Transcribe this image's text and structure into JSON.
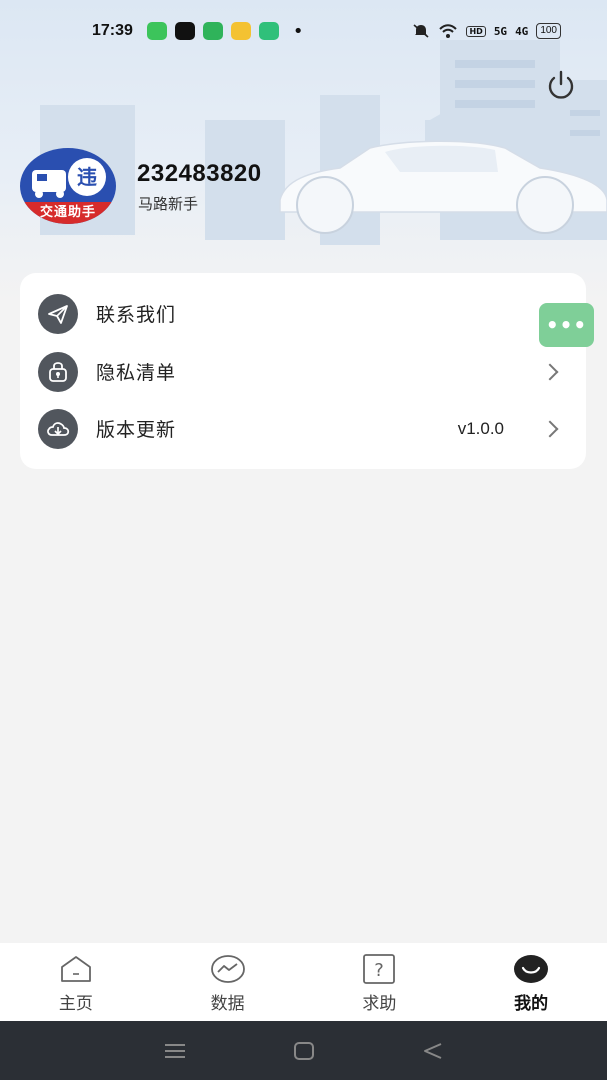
{
  "status_bar": {
    "time": "17:39",
    "dot": "•",
    "hd_label": "HD",
    "signal1": "5G",
    "signal2": "4G",
    "battery": "100"
  },
  "user": {
    "id": "232483820",
    "level": "马路新手",
    "avatar_badge": "违",
    "avatar_band_text": "交通助手"
  },
  "menu": {
    "items": [
      {
        "label": "联系我们",
        "icon": "send-icon",
        "value": ""
      },
      {
        "label": "隐私清单",
        "icon": "lock-icon",
        "value": ""
      },
      {
        "label": "版本更新",
        "icon": "cloud-download-icon",
        "value": "v1.0.0"
      }
    ]
  },
  "float_button": {
    "label": "•••"
  },
  "tabs": [
    {
      "label": "主页",
      "icon": "home-icon",
      "active": false
    },
    {
      "label": "数据",
      "icon": "chart-icon",
      "active": false
    },
    {
      "label": "求助",
      "icon": "help-icon",
      "active": false
    },
    {
      "label": "我的",
      "icon": "profile-icon",
      "active": true
    }
  ],
  "colors": {
    "header_bg": "#dce7f3",
    "card_bg": "#ffffff",
    "icon_bg": "#51565d",
    "float_btn": "#7fcf98",
    "nav_bg": "#2b2f35"
  }
}
